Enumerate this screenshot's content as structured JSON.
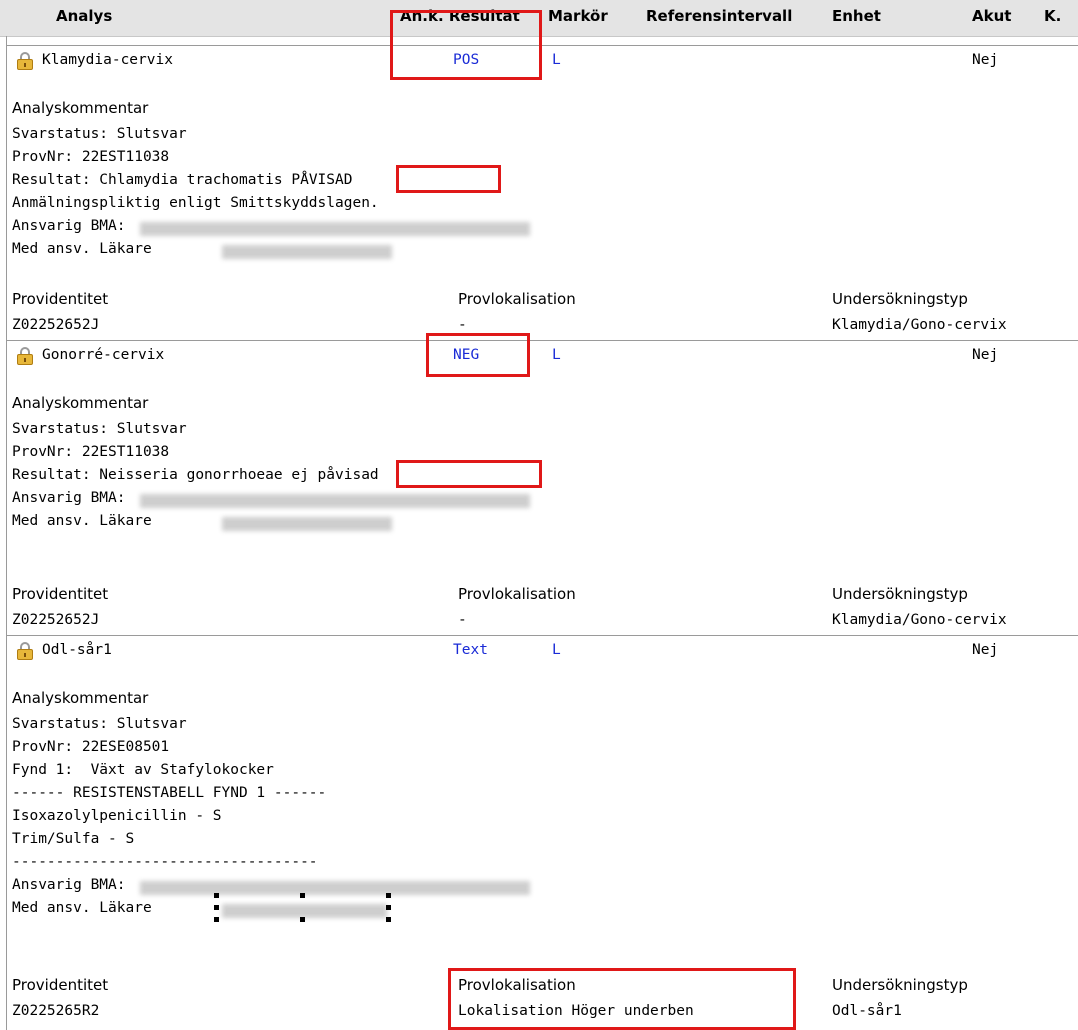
{
  "columns": {
    "analys": "Analys",
    "ank_resultat": "An.k. Resultat",
    "markor": "Markör",
    "referensintervall": "Referensintervall",
    "enhet": "Enhet",
    "akut": "Akut",
    "k": "K."
  },
  "entries": [
    {
      "analys": "Klamydia-cervix",
      "resultat": "POS",
      "markor": "L",
      "akut": "Nej",
      "comment_label": "Analyskommentar",
      "lines": {
        "status": "Svarstatus: Slutsvar",
        "provnr": "ProvNr: 22EST11038",
        "resultat_prefix": "Resultat: Chlamydia trachomatis ",
        "resultat_value": "PÅVISAD",
        "anmalan": "Anmälningspliktig enligt Smittskyddslagen.",
        "bma": "Ansvarig BMA:",
        "lakare": "Med ansv. Läkare"
      },
      "meta_labels": {
        "provid": "Providentitet",
        "provlok": "Provlokalisation",
        "undtyp": "Undersökningstyp"
      },
      "meta_values": {
        "provid": "Z02252652J",
        "provlok": "-",
        "undtyp": "Klamydia/Gono-cervix"
      }
    },
    {
      "analys": "Gonorré-cervix",
      "resultat": "NEG",
      "markor": "L",
      "akut": "Nej",
      "comment_label": "Analyskommentar",
      "lines": {
        "status": "Svarstatus: Slutsvar",
        "provnr": "ProvNr: 22EST11038",
        "resultat_prefix": "Resultat: Neisseria gonorrhoeae ",
        "resultat_value": "ej påvisad",
        "bma": "Ansvarig BMA:",
        "lakare": "Med ansv. Läkare"
      },
      "meta_labels": {
        "provid": "Providentitet",
        "provlok": "Provlokalisation",
        "undtyp": "Undersökningstyp"
      },
      "meta_values": {
        "provid": "Z02252652J",
        "provlok": "-",
        "undtyp": "Klamydia/Gono-cervix"
      }
    },
    {
      "analys": "Odl-sår1",
      "resultat": "Text",
      "markor": "L",
      "akut": "Nej",
      "comment_label": "Analyskommentar",
      "lines": {
        "status": "Svarstatus: Slutsvar",
        "provnr": "ProvNr: 22ESE08501",
        "fynd": "Fynd 1:  Växt av Stafylokocker",
        "tabell": "------ RESISTENSTABELL FYND 1 ------",
        "iso": "Isoxazolylpenicillin - S",
        "trim": "Trim/Sulfa - S",
        "dashes": "-----------------------------------",
        "bma": "Ansvarig BMA:",
        "lakare": "Med ansv. Läkare"
      },
      "meta_labels": {
        "provid": "Providentitet",
        "provlok": "Provlokalisation",
        "undtyp": "Undersökningstyp"
      },
      "meta_values": {
        "provid": "Z0225265R2",
        "provlok": "Lokalisation Höger underben",
        "undtyp": "Odl-sår1"
      }
    }
  ],
  "icons": {
    "lock": "lock-icon"
  },
  "colors": {
    "highlight_red": "#e01818",
    "result_blue": "#1a2bd6"
  }
}
